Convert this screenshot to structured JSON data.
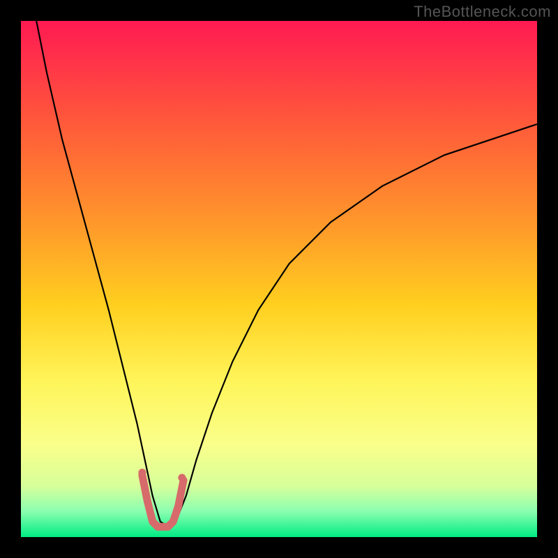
{
  "watermark": "TheBottleneck.com",
  "chart_data": {
    "type": "line",
    "title": "",
    "xlabel": "",
    "ylabel": "",
    "xlim": [
      0,
      100
    ],
    "ylim": [
      0,
      100
    ],
    "grid": false,
    "legend": false,
    "background_gradient_stops": [
      {
        "offset": 0.0,
        "color": "#ff1a52"
      },
      {
        "offset": 0.2,
        "color": "#ff5a3a"
      },
      {
        "offset": 0.4,
        "color": "#ff9a2a"
      },
      {
        "offset": 0.55,
        "color": "#ffcf1f"
      },
      {
        "offset": 0.7,
        "color": "#fff55a"
      },
      {
        "offset": 0.82,
        "color": "#faff8a"
      },
      {
        "offset": 0.9,
        "color": "#d8ff9a"
      },
      {
        "offset": 0.95,
        "color": "#8bffb0"
      },
      {
        "offset": 1.0,
        "color": "#00ec84"
      }
    ],
    "series": [
      {
        "name": "curve",
        "stroke": "#000000",
        "stroke_width": 2.2,
        "x": [
          3,
          5,
          8,
          11,
          14,
          17,
          19,
          21,
          22.5,
          24,
          25.5,
          27,
          28.5,
          30,
          32,
          34,
          37,
          41,
          46,
          52,
          60,
          70,
          82,
          100
        ],
        "y": [
          100,
          90,
          77,
          66,
          55,
          44,
          36,
          28,
          22,
          15,
          8,
          3,
          2,
          3,
          8,
          15,
          24,
          34,
          44,
          53,
          61,
          68,
          74,
          80
        ]
      },
      {
        "name": "highlight-band",
        "stroke": "#d76a6a",
        "stroke_width": 11,
        "linecap": "round",
        "x": [
          23.5,
          24.5,
          25.5,
          26.5,
          27.5,
          28.5,
          29.5,
          30.5,
          31.5
        ],
        "y": [
          12,
          7,
          3,
          2,
          2,
          2,
          3,
          6,
          11
        ]
      }
    ],
    "points": [
      {
        "x": 23.5,
        "y": 12.5,
        "r": 5.5,
        "fill": "#d76a6a"
      },
      {
        "x": 31.2,
        "y": 11.5,
        "r": 5.5,
        "fill": "#d76a6a"
      }
    ]
  }
}
